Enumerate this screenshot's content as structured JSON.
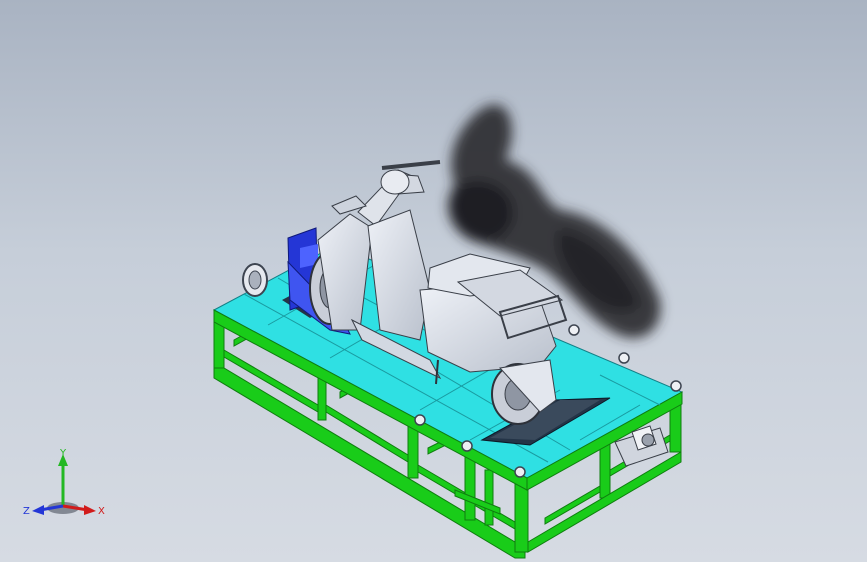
{
  "viewport": {
    "background_top": "#a9b3c2",
    "background_bottom": "#d6dbe3"
  },
  "model": {
    "frame_color": "#19cc19",
    "deck_color": "#2fe0e3",
    "body_color": "#d7dde8",
    "bracket_color": "#2436d6",
    "smoke_color": "#2c2c30"
  },
  "triad": {
    "x_label": "X",
    "y_label": "Y",
    "z_label": "Z",
    "x_color": "#d11b1b",
    "y_color": "#23b823",
    "z_color": "#2336d6"
  }
}
